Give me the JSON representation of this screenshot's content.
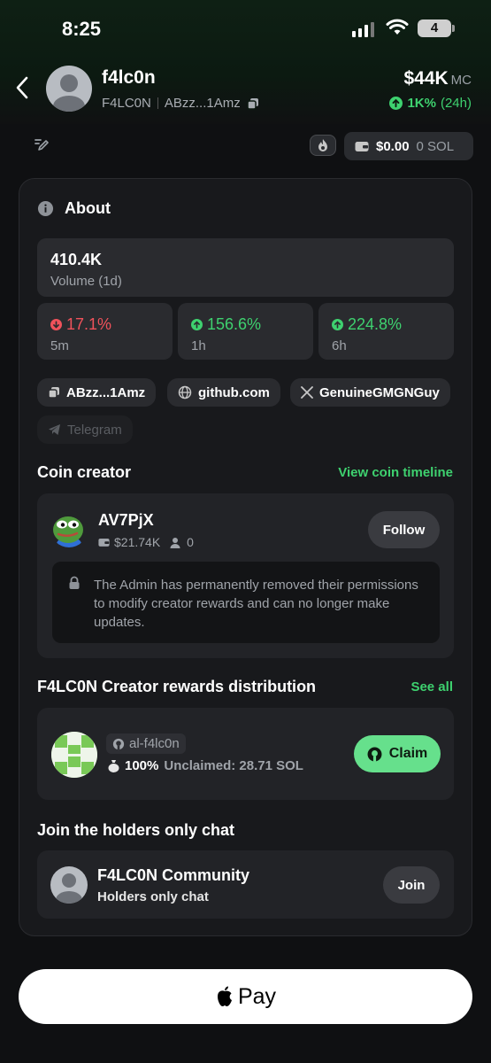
{
  "status_bar": {
    "time": "8:25",
    "battery": "4"
  },
  "header": {
    "coin_name": "f4lc0n",
    "ticker": "F4LC0N",
    "address": "ABzz...1Amz",
    "market_cap": "$44K",
    "market_cap_unit": "MC",
    "change": "1K%",
    "change_period": "(24h)"
  },
  "wallet": {
    "balance": "$0.00",
    "sol": "0 SOL"
  },
  "about": {
    "title": "About",
    "volume": {
      "value": "410.4K",
      "label": "Volume (1d)"
    },
    "changes": [
      {
        "value": "17.1%",
        "timeframe": "5m",
        "direction": "down"
      },
      {
        "value": "156.6%",
        "timeframe": "1h",
        "direction": "up"
      },
      {
        "value": "224.8%",
        "timeframe": "6h",
        "direction": "up"
      }
    ],
    "links": {
      "address": "ABzz...1Amz",
      "website": "github.com",
      "twitter": "GenuineGMGNGuy",
      "telegram": "Telegram"
    }
  },
  "creator": {
    "section_title": "Coin creator",
    "timeline_link": "View coin timeline",
    "name": "AV7PjX",
    "holdings": "$21.74K",
    "followers": "0",
    "follow_label": "Follow",
    "notice": "The Admin has permanently removed their permissions to modify creator rewards and can no longer make updates."
  },
  "rewards": {
    "section_title": "F4LC0N Creator rewards distribution",
    "see_all": "See all",
    "github_user": "al-f4lc0n",
    "share": "100%",
    "unclaimed": "Unclaimed: 28.71 SOL",
    "claim_label": "Claim"
  },
  "chat": {
    "section_title": "Join the holders only chat",
    "community_name": "F4LC0N Community",
    "community_sub": "Holders only chat",
    "join_label": "Join"
  },
  "pay": {
    "label": "Pay"
  },
  "colors": {
    "accent_green": "#3ed16f",
    "claim_green": "#66e08c",
    "down_red": "#f0525b"
  }
}
